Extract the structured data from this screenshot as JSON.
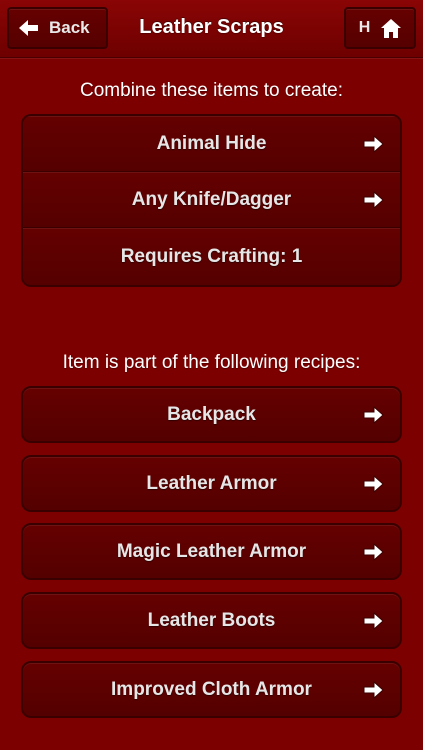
{
  "navbar": {
    "back_label": "Back",
    "title": "Leather Scraps",
    "home_label": "H"
  },
  "combine": {
    "heading": "Combine these items to create:",
    "items": [
      "Animal Hide",
      "Any Knife/Dagger"
    ],
    "requirement": "Requires Crafting: 1"
  },
  "recipes": {
    "heading": "Item is part of the following recipes:",
    "items": [
      "Backpack",
      "Leather Armor",
      "Magic Leather Armor",
      "Leather Boots",
      "Improved Cloth Armor"
    ]
  },
  "icons": {
    "back": "left-arrow-icon",
    "home": "home-icon",
    "row_arrow": "right-arrow-icon"
  },
  "colors": {
    "background": "#7d0000",
    "button": "#5c0000",
    "border": "#3a0000",
    "text": "#e6e6e6"
  }
}
